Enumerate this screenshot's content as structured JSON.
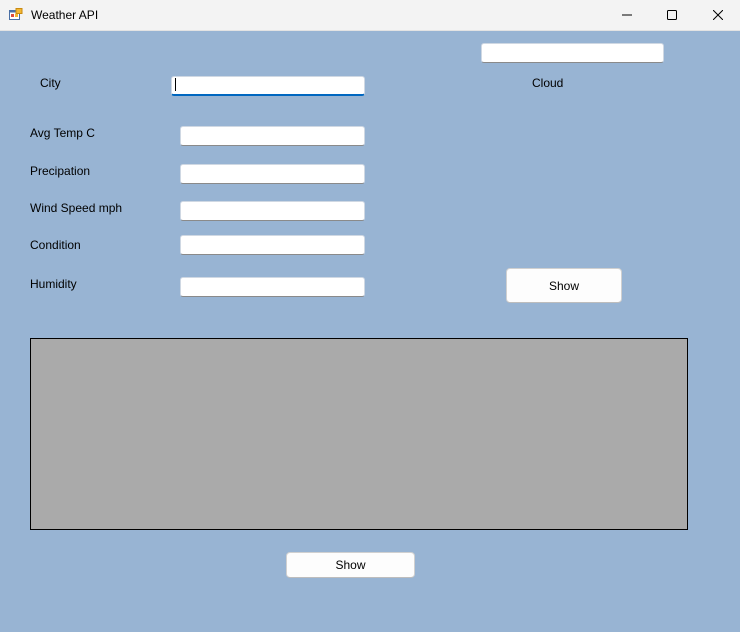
{
  "window": {
    "title": "Weather API",
    "icons": {
      "app": "windows-forms-app-icon",
      "minimize": "minimize-icon",
      "maximize": "maximize-icon",
      "close": "close-icon"
    }
  },
  "form": {
    "city_label": "City",
    "city_value": "",
    "cloud_label": "Cloud",
    "cloud_value": "",
    "avg_temp_label": "Avg Temp C",
    "avg_temp_value": "",
    "precipitation_label": "Precipation",
    "precipitation_value": "",
    "wind_speed_label": "Wind Speed mph",
    "wind_speed_value": "",
    "condition_label": "Condition",
    "condition_value": "",
    "humidity_label": "Humidity",
    "humidity_value": "",
    "show_button_top": "Show",
    "show_button_bottom": "Show"
  },
  "colors": {
    "form_background": "#98b4d3",
    "panel_background": "#aaaaaa",
    "focus_accent": "#0067c0"
  }
}
